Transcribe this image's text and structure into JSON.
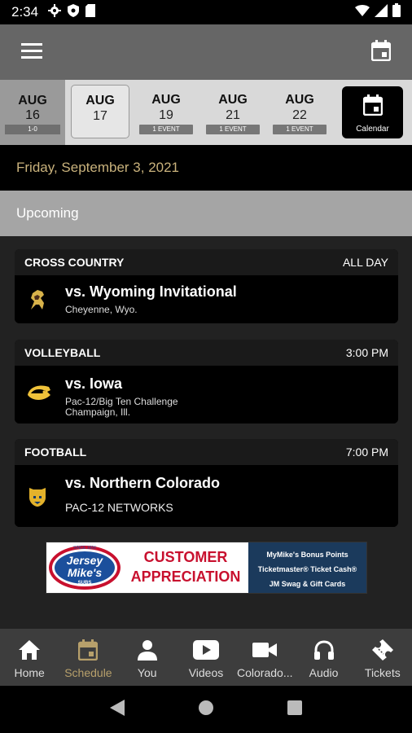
{
  "status_bar": {
    "time": "2:34"
  },
  "date_strip": {
    "first": {
      "month": "AUG",
      "day": "16",
      "badge": "1-0"
    },
    "items": [
      {
        "month": "AUG",
        "day": "17",
        "badge": ""
      },
      {
        "month": "AUG",
        "day": "19",
        "badge": "1 EVENT"
      },
      {
        "month": "AUG",
        "day": "21",
        "badge": "1 EVENT"
      },
      {
        "month": "AUG",
        "day": "22",
        "badge": "1 EVENT"
      }
    ],
    "calendar_label": "Calendar"
  },
  "date_heading": "Friday, September 3, 2021",
  "section_label": "Upcoming",
  "events": [
    {
      "sport": "CROSS COUNTRY",
      "time": "ALL DAY",
      "title": "vs. Wyoming Invitational",
      "sub1": "Cheyenne, Wyo.",
      "sub2": ""
    },
    {
      "sport": "VOLLEYBALL",
      "time": "3:00 PM",
      "title": "vs. Iowa",
      "sub1": "Pac-12/Big Ten Challenge",
      "sub2": "Champaign, Ill."
    },
    {
      "sport": "FOOTBALL",
      "time": "7:00 PM",
      "title": "vs. Northern Colorado",
      "sub1": "PAC-12 NETWORKS",
      "sub2": ""
    }
  ],
  "ad": {
    "logo_top": "SINCE 1956",
    "logo_line1": "Jersey",
    "logo_line2": "Mike's",
    "logo_line3": "SUBS",
    "main_line1": "CUSTOMER",
    "main_line2": "APPRECIATION",
    "side_line1": "MyMike's Bonus Points",
    "side_line2": "Ticketmaster® Ticket Cash®",
    "side_line3": "JM Swag & Gift Cards"
  },
  "bottom_nav": [
    {
      "label": "Home",
      "icon": "home-icon"
    },
    {
      "label": "Schedule",
      "icon": "calendar-icon"
    },
    {
      "label": "You",
      "icon": "person-icon"
    },
    {
      "label": "Videos",
      "icon": "play-icon"
    },
    {
      "label": "Colorado...",
      "icon": "video-camera-icon"
    },
    {
      "label": "Audio",
      "icon": "headphones-icon"
    },
    {
      "label": "Tickets",
      "icon": "ticket-icon"
    }
  ],
  "colors": {
    "accent": "#b7a06b",
    "date_heading": "#c9b27c",
    "app_bar": "#666666",
    "upcoming_bar": "#a5a5a5"
  }
}
